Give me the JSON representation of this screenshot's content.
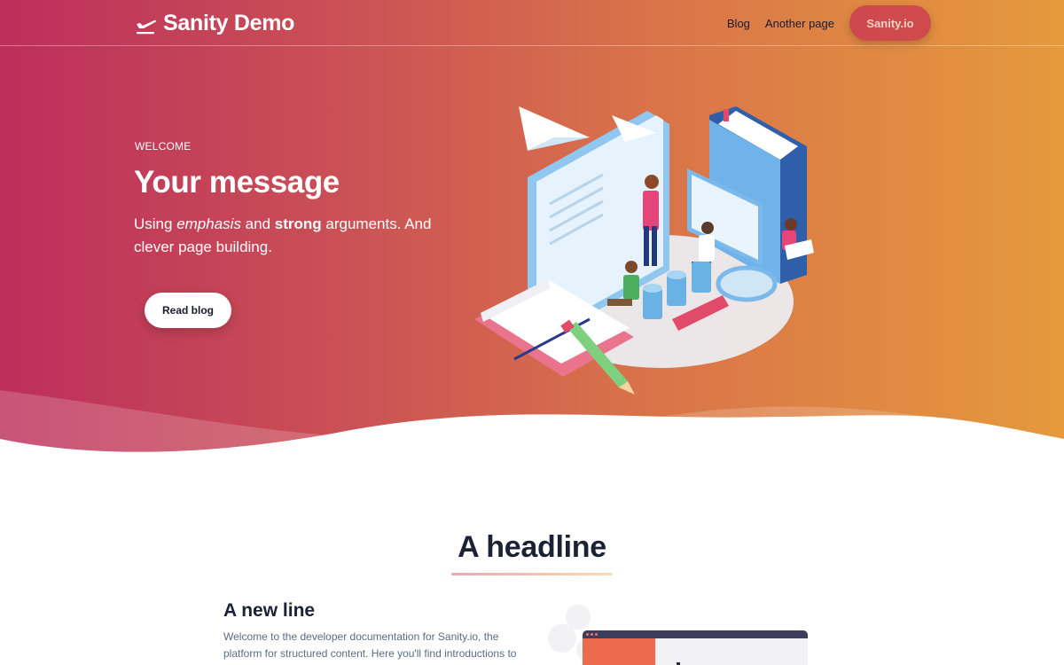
{
  "nav": {
    "brand": "Sanity Demo",
    "links": [
      {
        "label": "Blog"
      },
      {
        "label": "Another page"
      }
    ],
    "cta": "Sanity.io"
  },
  "hero": {
    "eyebrow": "WELCOME",
    "title": "Your message",
    "subtitle": {
      "prefix": "Using ",
      "emphasis": "emphasis",
      "middle": " and ",
      "strong": "strong",
      "suffix": " arguments. And clever page building."
    },
    "button": "Read blog"
  },
  "section": {
    "headline": "A headline",
    "subheading": "A new line",
    "body": "Welcome to the developer documentation for Sanity.io, the platform for structured content. Here you'll find introductions to all features, as well as resources, guides, and reference documentation for APIs."
  },
  "colors": {
    "gradient_start": "#bd2f5b",
    "gradient_end": "#e59a3c",
    "heading": "#1c2233",
    "body": "#5b6b86"
  },
  "icons": {
    "brand_logo": "airplane-takeoff-icon"
  }
}
